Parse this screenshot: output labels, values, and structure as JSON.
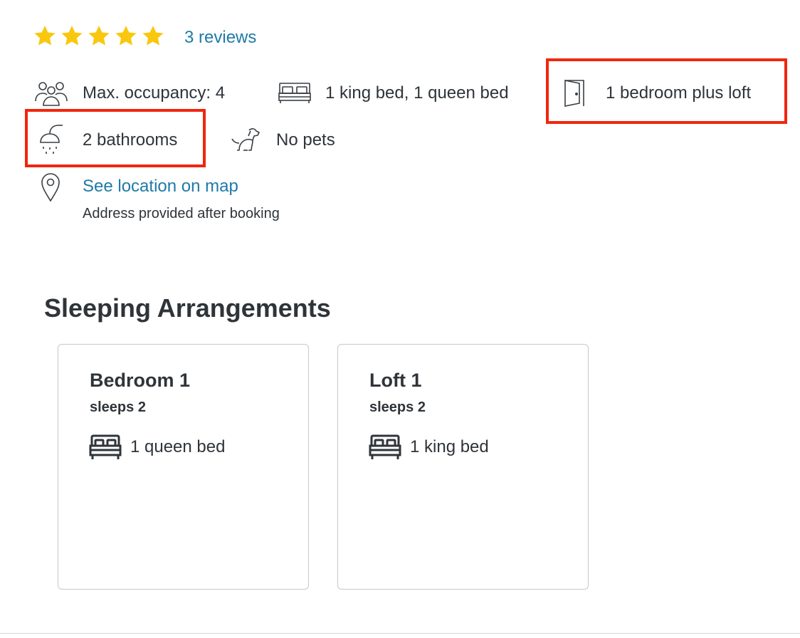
{
  "rating": {
    "stars": 5,
    "max_stars": 5,
    "star_color": "#f9c80e",
    "reviews_link": "3 reviews"
  },
  "amenities": {
    "occupancy": {
      "icon": "people-icon",
      "label": "Max. occupancy: 4"
    },
    "beds": {
      "icon": "bed-icon",
      "label": "1 king bed, 1 queen bed"
    },
    "bedrooms": {
      "icon": "door-icon",
      "label": "1 bedroom plus loft"
    },
    "bathrooms": {
      "icon": "shower-icon",
      "label": "2 bathrooms"
    },
    "pets": {
      "icon": "dog-icon",
      "label": "No pets"
    }
  },
  "location": {
    "icon": "map-pin-icon",
    "link": "See location on map",
    "note": "Address provided after booking"
  },
  "highlight_color": "#f0260f",
  "link_color": "#1f7aa8",
  "sleeping": {
    "title": "Sleeping Arrangements",
    "rooms": [
      {
        "name": "Bedroom 1",
        "sleeps": "sleeps 2",
        "bed_icon": "bed-icon",
        "bed": "1 queen bed"
      },
      {
        "name": "Loft 1",
        "sleeps": "sleeps 2",
        "bed_icon": "bed-icon",
        "bed": "1 king bed"
      }
    ]
  }
}
